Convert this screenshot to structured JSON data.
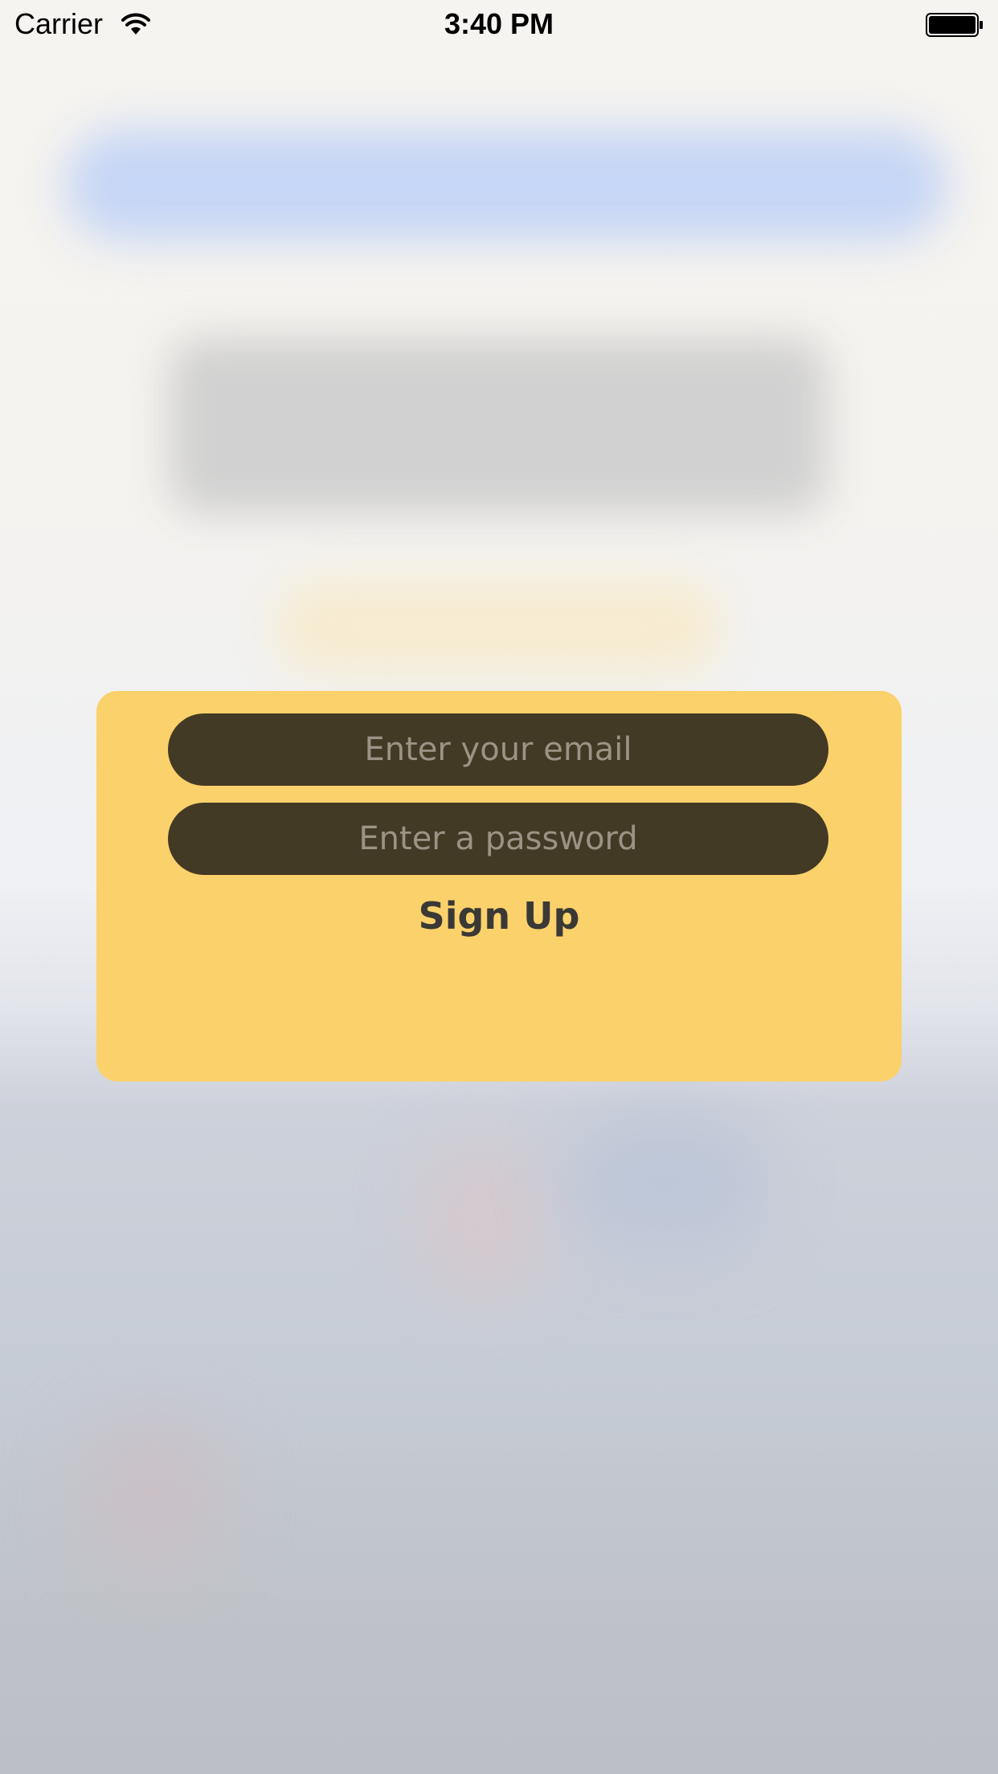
{
  "status_bar": {
    "carrier": "Carrier",
    "time": "3:40 PM",
    "wifi_icon": "wifi-icon",
    "battery_icon": "battery-icon"
  },
  "signup_form": {
    "email_placeholder": "Enter your email",
    "email_value": "",
    "password_placeholder": "Enter a password",
    "password_value": "",
    "submit_label": "Sign Up"
  },
  "colors": {
    "card_background": "#fbd16b",
    "input_background": "#433a25",
    "placeholder_text": "#9a9486",
    "button_text": "#3a3935"
  }
}
